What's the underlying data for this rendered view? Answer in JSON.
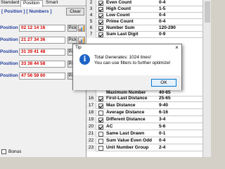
{
  "tabs": [
    "Standard",
    "Position",
    "Smart"
  ],
  "config_label": "[ Position ]  [ Numbers ]",
  "clear_label": "Clear",
  "pick_label": "Pick",
  "positions": [
    {
      "label": "Position 1:",
      "value": "02 12 14 16"
    },
    {
      "label": "Position 2:",
      "value": "21 27 34 36"
    },
    {
      "label": "Position 3:",
      "value": "31 39 41 48"
    },
    {
      "label": "Position 4:",
      "value": "33 38 44 58"
    },
    {
      "label": "Position 5:",
      "value": "47 56 59 60"
    }
  ],
  "bonus_label": "Bonus",
  "grid_top": [
    {
      "n": "2",
      "name": "Even Count",
      "val": "0-4",
      "checked": true
    },
    {
      "n": "3",
      "name": "High Count",
      "val": "1-5",
      "checked": true
    },
    {
      "n": "4",
      "name": "Low Count",
      "val": "0-4",
      "checked": true
    },
    {
      "n": "5",
      "name": "Prime Count",
      "val": "0-4",
      "checked": true
    },
    {
      "n": "6",
      "name": "Number Sum",
      "val": "120-290",
      "checked": true
    },
    {
      "n": "7",
      "name": "Sum Last Digit",
      "val": "0-9",
      "checked": true
    }
  ],
  "grid_partial": {
    "name": "Maximum Number",
    "val": "40-65"
  },
  "grid_bottom": [
    {
      "n": "16",
      "name": "First-Last Distance",
      "val": "25-65",
      "checked": true
    },
    {
      "n": "17",
      "name": "Max Distance",
      "val": "9-40",
      "checked": true
    },
    {
      "n": "18",
      "name": "Average Distance",
      "val": "6-16",
      "checked": false
    },
    {
      "n": "19",
      "name": "Different Distance",
      "val": "3-4",
      "checked": true
    },
    {
      "n": "20",
      "name": "AC",
      "val": "5-6",
      "checked": true
    },
    {
      "n": "21",
      "name": "Same Last Drawn",
      "val": "0-1",
      "checked": false
    },
    {
      "n": "22",
      "name": "Sum Value Even Odd",
      "val": "0-4",
      "checked": false
    },
    {
      "n": "23",
      "name": "Unit Number Group",
      "val": "2-4",
      "checked": false
    }
  ],
  "dialog": {
    "title": "Tip",
    "line1": "Total Generates: 1024 lines!",
    "line2": "You can use filters to further optimize!",
    "ok_label": "OK",
    "close_glyph": "×",
    "icon_glyph": "i"
  }
}
